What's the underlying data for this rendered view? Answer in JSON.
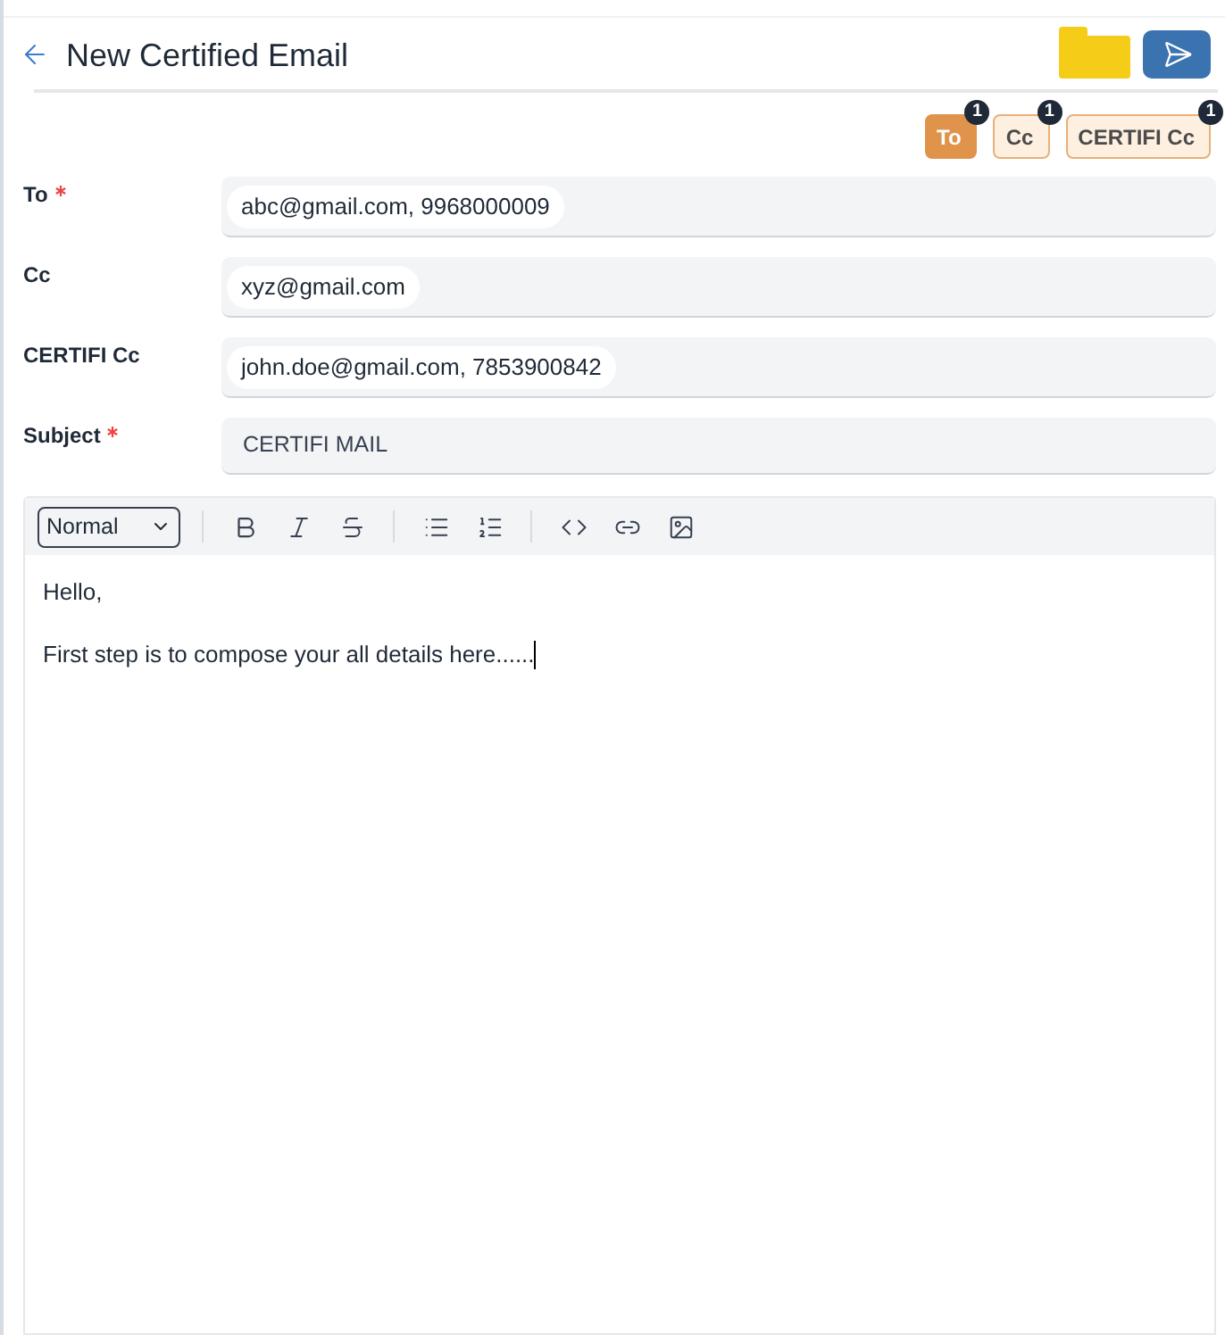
{
  "header": {
    "title": "New Certified Email"
  },
  "recipient_tabs": [
    {
      "label": "To",
      "count": "1",
      "selected": true
    },
    {
      "label": "Cc",
      "count": "1",
      "selected": false
    },
    {
      "label": "CERTIFI Cc",
      "count": "1",
      "selected": false
    }
  ],
  "fields": [
    {
      "kind": "chips",
      "label": "To",
      "required": true,
      "chips": [
        "abc@gmail.com, 9968000009"
      ]
    },
    {
      "kind": "chips",
      "label": "Cc",
      "required": false,
      "chips": [
        "xyz@gmail.com"
      ]
    },
    {
      "kind": "chips",
      "label": "CERTIFI Cc",
      "required": false,
      "chips": [
        "john.doe@gmail.com, 7853900842"
      ]
    },
    {
      "kind": "text",
      "label": "Subject",
      "required": true,
      "value": "CERTIFI MAIL"
    }
  ],
  "editor": {
    "format": "Normal",
    "paragraphs": [
      "Hello,",
      "First step is to compose your all details here......"
    ],
    "focused": true
  }
}
